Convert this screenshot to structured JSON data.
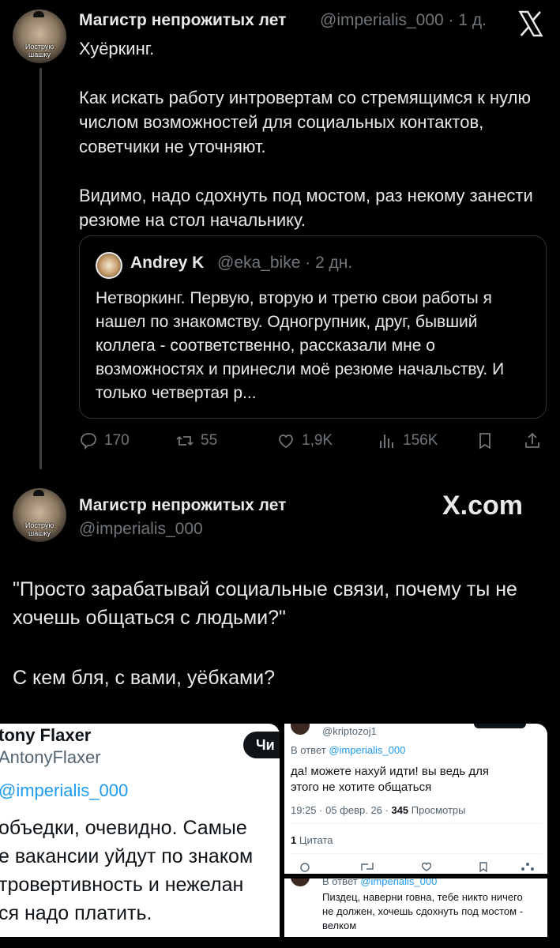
{
  "post1": {
    "author_name": "Магистр непрожитых лет",
    "handle_time": "@imperialis_000 · 1 д.",
    "avatar_caption_line1": "Иострую",
    "avatar_caption_line2": "шашку",
    "paragraphs": [
      "Хуёркинг.",
      "Как искать работу интровертам со стремящимся к нулю числом возможностей для социальных контактов, советчики не уточняют.",
      "Видимо, надо сдохнуть под мостом, раз некому занести резюме на стол начальнику."
    ],
    "quote": {
      "author_name": "Andrey K",
      "handle_time": "@eka_bike · 2 дн.",
      "text": "Нетворкинг. Первую, вторую и третю свои работы я нашел по знакомству. Одногрупник, друг, бывший коллега - соответственно, рассказали мне о возможностях и принесли моё резюме начальству. И только четвертая р..."
    },
    "actions": {
      "replies": "170",
      "reposts": "55",
      "likes": "1,9K",
      "views": "156K"
    }
  },
  "post2": {
    "author_name": "Магистр непрожитых лет",
    "handle": "@imperialis_000",
    "watermark": "X.com",
    "avatar_caption_line1": "Иострую",
    "avatar_caption_line2": "шашку",
    "paragraph1": "\"Просто зарабатывай социальные связи, почему ты не хочешь общаться с людьми?\"",
    "paragraph2": "С кем бля, с вами, уёбками?"
  },
  "shot_left": {
    "name_fragment": "tony Flaxer",
    "handle_fragment": "AntonyFlaxer",
    "follow_fragment": "Чи",
    "mention_fragment": "@imperialis_000",
    "lines": [
      "объедки, очевидно. Самые",
      "е вакансии уйдут по знаком",
      "тровертивность и нежелан",
      "ся надо платить."
    ]
  },
  "shot_right_top": {
    "handle": "@kriptozoj1",
    "reply_to_prefix": "В ответ",
    "reply_to_handle": "@imperialis_000",
    "text_line1": "да! можете нахуй идти! вы ведь для",
    "text_line2": "этого не хотите общаться",
    "meta_prefix": "19:25 · 05 февр. 26 ·",
    "views_count": "345",
    "views_label": "Просмотры",
    "quotes_count": "1",
    "quotes_label": "Цитата"
  },
  "shot_right_bottom": {
    "reply_to_prefix": "В ответ",
    "reply_to_handle": "@imperialis_000",
    "text_line1": "Пиздец, наверни говна, тебе никто ничего",
    "text_line2": "не должен, хочешь сдохнуть под мостом -",
    "text_line3": "велком"
  },
  "icons": [
    "x-logo-icon",
    "reply-icon",
    "repost-icon",
    "like-icon",
    "views-icon",
    "bookmark-icon",
    "share-icon"
  ],
  "colors": {
    "background": "#000000",
    "muted": "#71767b",
    "link": "#1d9bf0",
    "text": "#e7e9ea"
  }
}
